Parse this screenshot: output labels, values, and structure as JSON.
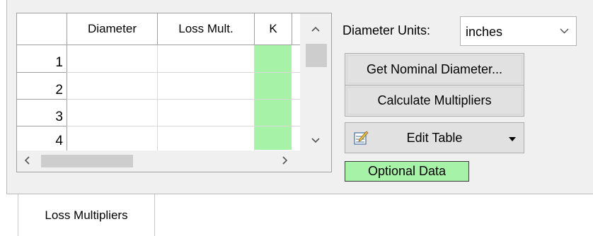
{
  "grid": {
    "columns": [
      "Diameter",
      "Loss Mult.",
      "K"
    ],
    "rows": [
      {
        "num": "1",
        "diameter": "",
        "loss_mult": "",
        "k": ""
      },
      {
        "num": "2",
        "diameter": "",
        "loss_mult": "",
        "k": ""
      },
      {
        "num": "3",
        "diameter": "",
        "loss_mult": "",
        "k": ""
      },
      {
        "num": "4",
        "diameter": "",
        "loss_mult": "",
        "k": ""
      }
    ]
  },
  "settings": {
    "diameter_units_label": "Diameter Units:",
    "diameter_units_value": "inches"
  },
  "buttons": {
    "get_nominal": "Get Nominal Diameter...",
    "calculate": "Calculate Multipliers",
    "edit_table": "Edit Table"
  },
  "badge": {
    "optional_data": "Optional Data"
  },
  "tabs": [
    {
      "label": "Loss Multipliers"
    }
  ],
  "colors": {
    "k_column_fill": "#a6f2a6",
    "optional_badge_fill": "#a6f2a6",
    "panel_background": "#f0f0f0"
  },
  "icons": {
    "scroll_up": "chevron-up-icon",
    "scroll_down": "chevron-down-icon",
    "scroll_left": "chevron-left-icon",
    "scroll_right": "chevron-right-icon",
    "edit_table": "edit-table-icon",
    "dropdown": "dropdown-caret-icon"
  }
}
